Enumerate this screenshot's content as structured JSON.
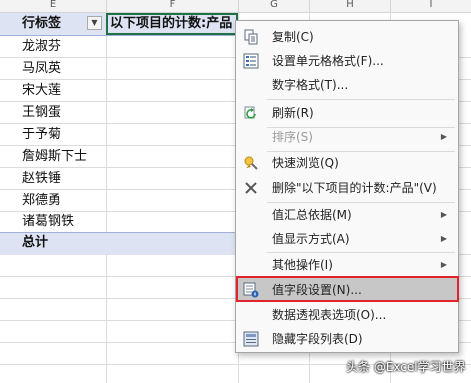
{
  "columns": {
    "e": "E",
    "f": "F",
    "g": "G",
    "h": "H",
    "i": "I"
  },
  "pivot": {
    "row_header": "行标签",
    "value_header": "以下项目的计数:产品",
    "rows": [
      "龙淑芬",
      "马凤英",
      "宋大莲",
      "王钢蛋",
      "于予菊",
      "詹姆斯下士",
      "赵铁锤",
      "郑德勇",
      "诸葛钢铁"
    ],
    "total_label": "总计"
  },
  "context_menu": {
    "items": [
      {
        "id": "copy",
        "label": "复制(C)",
        "icon": "copy-icon",
        "enabled": true,
        "submenu": false
      },
      {
        "id": "format-cells",
        "label": "设置单元格格式(F)...",
        "icon": "format-cells-icon",
        "enabled": true,
        "submenu": false
      },
      {
        "id": "number-format",
        "label": "数字格式(T)...",
        "icon": "",
        "enabled": true,
        "submenu": false
      },
      {
        "id": "refresh",
        "label": "刷新(R)",
        "icon": "refresh-icon",
        "enabled": true,
        "submenu": false
      },
      {
        "id": "sort",
        "label": "排序(S)",
        "icon": "",
        "enabled": false,
        "submenu": true
      },
      {
        "id": "quick-explore",
        "label": "快速浏览(Q)",
        "icon": "quick-explore-icon",
        "enabled": true,
        "submenu": false
      },
      {
        "id": "remove-field",
        "label": "删除\"以下项目的计数:产品\"(V)",
        "icon": "delete-icon",
        "enabled": true,
        "submenu": false
      },
      {
        "id": "summarize-by",
        "label": "值汇总依据(M)",
        "icon": "",
        "enabled": true,
        "submenu": true
      },
      {
        "id": "show-values-as",
        "label": "值显示方式(A)",
        "icon": "",
        "enabled": true,
        "submenu": true
      },
      {
        "id": "other-actions",
        "label": "其他操作(I)",
        "icon": "",
        "enabled": true,
        "submenu": true
      },
      {
        "id": "value-field-settings",
        "label": "值字段设置(N)...",
        "icon": "value-field-settings-icon",
        "enabled": true,
        "submenu": false,
        "highlighted": true
      },
      {
        "id": "pivot-options",
        "label": "数据透视表选项(O)...",
        "icon": "",
        "enabled": true,
        "submenu": false
      },
      {
        "id": "hide-field-list",
        "label": "隐藏字段列表(D)",
        "icon": "field-list-icon",
        "enabled": true,
        "submenu": false
      }
    ]
  },
  "watermark": "头条 @Excel学习世界",
  "colors": {
    "header_band": "#dde3f2",
    "selection_border": "#1f7244",
    "highlight_border": "#e0242b",
    "menu_highlight": "#c7c7c7"
  }
}
